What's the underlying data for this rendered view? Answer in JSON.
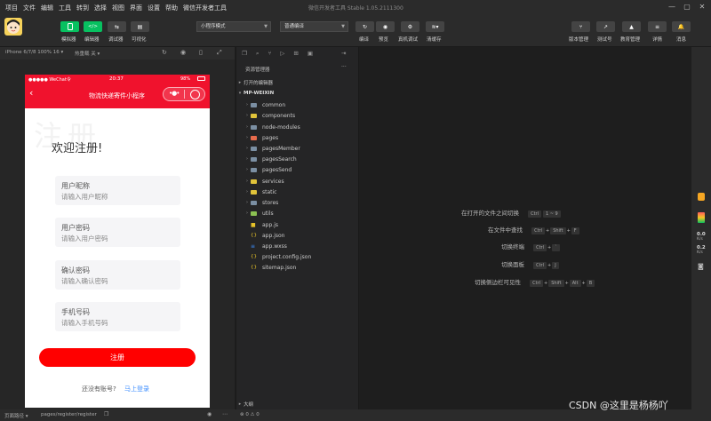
{
  "menu": {
    "items": [
      "项目",
      "文件",
      "编辑",
      "工具",
      "转到",
      "选择",
      "视图",
      "界面",
      "设置",
      "帮助",
      "微信开发者工具"
    ],
    "window_title": "微信开发者工具 Stable 1.05.2111300"
  },
  "toolbar": {
    "simulator_label": "模拟器",
    "editor_label": "编辑器",
    "debugger_label": "调试器",
    "visual_label": "可视化",
    "mode_select": "小程序模式",
    "compile_select": "普通编译",
    "compile_label": "编译",
    "preview_label": "预览",
    "realdevice_label": "真机调试",
    "clearcache_label": "清缓存",
    "version_label": "版本管理",
    "testno_label": "测试号",
    "edu_label": "教育管理",
    "details_label": "详情",
    "messages_label": "消息",
    "editor_icon_text": "</>"
  },
  "simulator": {
    "device": "iPhone 6/7/8 100% 16 ▾",
    "hotreload": "热重载 关 ▾",
    "status_carrier": "●●●●● WeChat令",
    "status_time": "20:37",
    "status_battery": "98%",
    "nav_title": "物流快递寄件小程序",
    "watermark": "注册",
    "heading": "欢迎注册!",
    "fields": [
      {
        "label": "用户昵称",
        "placeholder": "请输入用户昵称"
      },
      {
        "label": "用户密码",
        "placeholder": "请输入用户密码"
      },
      {
        "label": "确认密码",
        "placeholder": "请输入确认密码"
      },
      {
        "label": "手机号码",
        "placeholder": "请输入手机号码"
      }
    ],
    "register_button": "注册",
    "has_account": "还没有账号?",
    "login_link": "马上登录"
  },
  "explorer": {
    "header": "资源管理器",
    "more": "···",
    "open_editors": "打开的编辑器",
    "project": "MP-WEIXIN",
    "folders": [
      "common",
      "components",
      "node-modules",
      "pages",
      "pagesMember",
      "pagesSearch",
      "pagesSend",
      "services",
      "static",
      "stores",
      "utils"
    ],
    "files": [
      "app.js",
      "app.json",
      "app.wxss",
      "project.config.json",
      "sitemap.json"
    ],
    "outline": "大纲",
    "problems": "⊗ 0 ⚠ 0"
  },
  "editor": {
    "shortcuts": [
      {
        "label": "在打开的文件之间切换",
        "keys": [
          "Ctrl",
          "1 ~ 9"
        ]
      },
      {
        "label": "在文件中查找",
        "keys": [
          "Ctrl",
          "+",
          "Shift",
          "+",
          "F"
        ]
      },
      {
        "label": "切换终端",
        "keys": [
          "Ctrl",
          "+",
          "`"
        ]
      },
      {
        "label": "切换面板",
        "keys": [
          "Ctrl",
          "+",
          "J"
        ]
      },
      {
        "label": "切换侧边栏可见性",
        "keys": [
          "Ctrl",
          "+",
          "Shift",
          "+",
          "Alt",
          "+",
          "B"
        ]
      }
    ]
  },
  "rightstrip": {
    "net_down": "0.0",
    "net_down_unit": "K/s",
    "net_up": "0.2",
    "net_up_unit": "K/s"
  },
  "status": {
    "page_path_label": "页面路径 ▾",
    "page_path": "pages/register/register",
    "watermark": "CSDN @这里是杨杨吖"
  },
  "colors": {
    "accent_green": "#07c160",
    "brand_red": "#f0122d",
    "button_red": "#ff0000",
    "link_blue": "#3d8eff"
  }
}
